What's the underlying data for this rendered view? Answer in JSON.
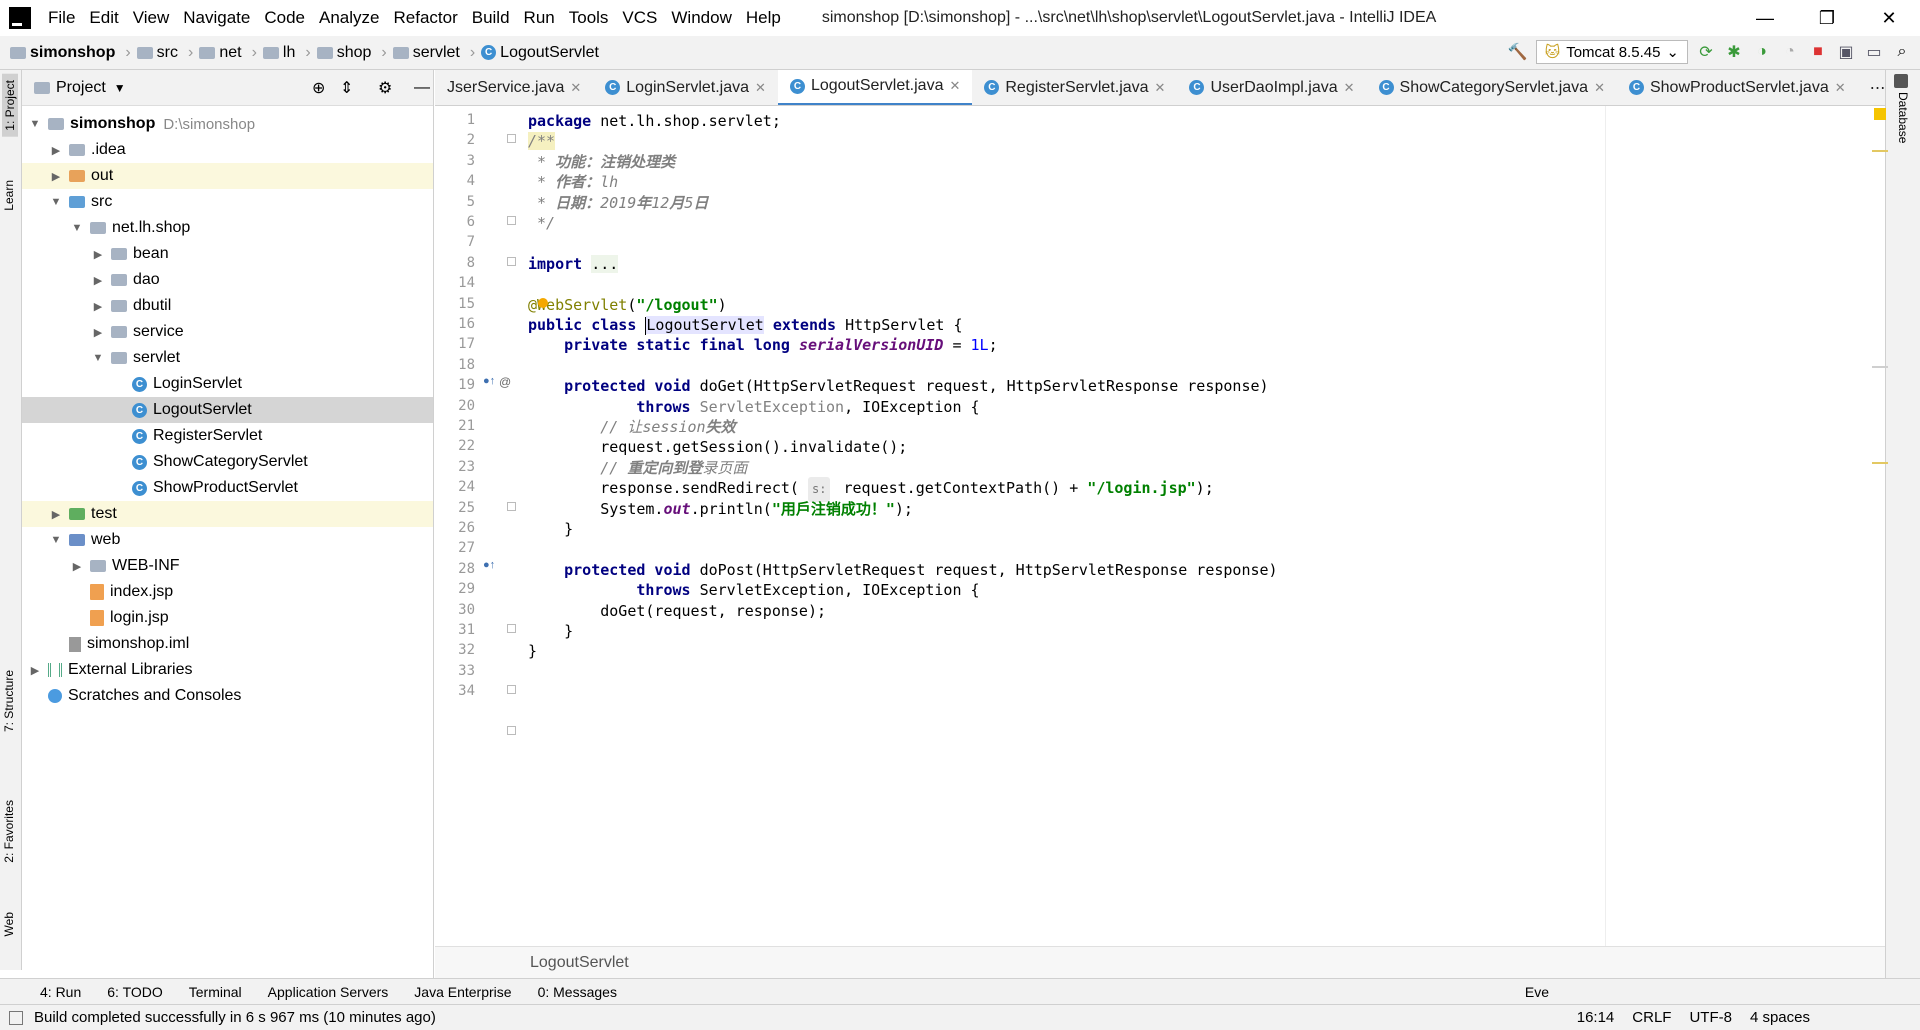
{
  "window": {
    "title": "simonshop [D:\\simonshop] - ...\\src\\net\\lh\\shop\\servlet\\LogoutServlet.java - IntelliJ IDEA",
    "minimize": "—",
    "maximize": "❐",
    "close": "✕"
  },
  "menu": [
    "File",
    "Edit",
    "View",
    "Navigate",
    "Code",
    "Analyze",
    "Refactor",
    "Build",
    "Run",
    "Tools",
    "VCS",
    "Window",
    "Help"
  ],
  "breadcrumb": [
    "simonshop",
    "src",
    "net",
    "lh",
    "shop",
    "servlet",
    "LogoutServlet"
  ],
  "run_config": "Tomcat 8.5.45",
  "left_tabs": {
    "project": "1: Project",
    "learn": "Learn",
    "structure": "7: Structure",
    "favorites": "2: Favorites",
    "web": "Web"
  },
  "right_tabs": {
    "database": "Database"
  },
  "project_panel": {
    "title": "Project",
    "tree": [
      {
        "label": "simonshop",
        "extra": "D:\\simonshop",
        "indent": 0,
        "arrow": "▼",
        "icon": "folder"
      },
      {
        "label": ".idea",
        "indent": 1,
        "arrow": "▶",
        "icon": "folder"
      },
      {
        "label": "out",
        "indent": 1,
        "arrow": "▶",
        "icon": "folder-orange",
        "hl": true
      },
      {
        "label": "src",
        "indent": 1,
        "arrow": "▼",
        "icon": "folder-blue"
      },
      {
        "label": "net.lh.shop",
        "indent": 2,
        "arrow": "▼",
        "icon": "package"
      },
      {
        "label": "bean",
        "indent": 3,
        "arrow": "▶",
        "icon": "package"
      },
      {
        "label": "dao",
        "indent": 3,
        "arrow": "▶",
        "icon": "package"
      },
      {
        "label": "dbutil",
        "indent": 3,
        "arrow": "▶",
        "icon": "package"
      },
      {
        "label": "service",
        "indent": 3,
        "arrow": "▶",
        "icon": "package"
      },
      {
        "label": "servlet",
        "indent": 3,
        "arrow": "▼",
        "icon": "package"
      },
      {
        "label": "LoginServlet",
        "indent": 4,
        "arrow": "",
        "icon": "class"
      },
      {
        "label": "LogoutServlet",
        "indent": 4,
        "arrow": "",
        "icon": "class",
        "sel": true
      },
      {
        "label": "RegisterServlet",
        "indent": 4,
        "arrow": "",
        "icon": "class"
      },
      {
        "label": "ShowCategoryServlet",
        "indent": 4,
        "arrow": "",
        "icon": "class"
      },
      {
        "label": "ShowProductServlet",
        "indent": 4,
        "arrow": "",
        "icon": "class"
      },
      {
        "label": "test",
        "indent": 1,
        "arrow": "▶",
        "icon": "folder-green",
        "hl": true
      },
      {
        "label": "web",
        "indent": 1,
        "arrow": "▼",
        "icon": "folder-web"
      },
      {
        "label": "WEB-INF",
        "indent": 2,
        "arrow": "▶",
        "icon": "folder"
      },
      {
        "label": "index.jsp",
        "indent": 2,
        "arrow": "",
        "icon": "jsp"
      },
      {
        "label": "login.jsp",
        "indent": 2,
        "arrow": "",
        "icon": "jsp"
      },
      {
        "label": "simonshop.iml",
        "indent": 1,
        "arrow": "",
        "icon": "file"
      },
      {
        "label": "External Libraries",
        "indent": 0,
        "arrow": "▶",
        "icon": "lib"
      },
      {
        "label": "Scratches and Consoles",
        "indent": 0,
        "arrow": "",
        "icon": "scratch"
      }
    ]
  },
  "editor_tabs": [
    {
      "label": "JserService.java",
      "active": false
    },
    {
      "label": "LoginServlet.java",
      "active": false
    },
    {
      "label": "LogoutServlet.java",
      "active": true
    },
    {
      "label": "RegisterServlet.java",
      "active": false
    },
    {
      "label": "UserDaoImpl.java",
      "active": false
    },
    {
      "label": "ShowCategoryServlet.java",
      "active": false
    },
    {
      "label": "ShowProductServlet.java",
      "active": false
    }
  ],
  "code_lines": [
    {
      "n": "1",
      "html": "<span class='kw'>package</span> net.lh.shop.servlet;"
    },
    {
      "n": "2",
      "html": "<span class='cmt' style='background:#f5f0c0'>/**</span>"
    },
    {
      "n": "3",
      "html": "<span class='cmt'> * <b>功能：注销处理类</b></span>"
    },
    {
      "n": "4",
      "html": "<span class='cmt'> * <b>作者：</b>lh</span>"
    },
    {
      "n": "5",
      "html": "<span class='cmt'> * <b>日期：</b>2019<b>年</b>12<b>月</b>5<b>日</b></span>"
    },
    {
      "n": "6",
      "html": "<span class='cmt'> */</span>"
    },
    {
      "n": "7",
      "html": ""
    },
    {
      "n": "8",
      "html": "<span class='kw'>import</span> <span style='background:#eef5ea'>...</span>"
    },
    {
      "n": "14",
      "html": ""
    },
    {
      "n": "15",
      "html": "<span class='ann'>@WebServlet</span>(<span class='str'>\"/logout\"</span>)"
    },
    {
      "n": "16",
      "html": "<span class='kw'>public class</span> <span class='caret'></span><span class='ident'>LogoutServlet</span> <span class='kw'>extends</span> HttpServlet {"
    },
    {
      "n": "17",
      "html": "    <span class='kw'>private static final long</span> <span class='fld'>serialVersionUID</span> = <span class='num'>1L</span>;"
    },
    {
      "n": "18",
      "html": ""
    },
    {
      "n": "19",
      "html": "    <span class='kw'>protected void</span> doGet(HttpServletRequest request, HttpServletResponse response)"
    },
    {
      "n": "20",
      "html": "            <span class='kw'>throws</span> <span class='muted'>ServletException</span>, IOException {"
    },
    {
      "n": "21",
      "html": "        <span class='cmt'>// 让session<b>失效</b></span>"
    },
    {
      "n": "22",
      "html": "        request.getSession().invalidate();"
    },
    {
      "n": "23",
      "html": "        <span class='cmt'>// <b>重定向到登</b>录页面</span>"
    },
    {
      "n": "24",
      "html": "        response.sendRedirect( <span class='hint'>s:</span> request.getContextPath() + <span class='str'>\"/login.jsp\"</span>);"
    },
    {
      "n": "25",
      "html": "        System.<span class='fld'>out</span>.println(<span class='str'>\"用戶注销成功！\"</span>);"
    },
    {
      "n": "26",
      "html": "    }"
    },
    {
      "n": "27",
      "html": ""
    },
    {
      "n": "28",
      "html": "    <span class='kw'>protected void</span> doPost(HttpServletRequest request, HttpServletResponse response)"
    },
    {
      "n": "29",
      "html": "            <span class='kw'>throws</span> ServletException, IOException {"
    },
    {
      "n": "30",
      "html": "        doGet(request, response);"
    },
    {
      "n": "31",
      "html": "    }"
    },
    {
      "n": "32",
      "html": "}"
    },
    {
      "n": "33",
      "html": ""
    },
    {
      "n": "34",
      "html": ""
    }
  ],
  "editor_breadcrumb": "LogoutServlet",
  "tool_windows": [
    "4: Run",
    "6: TODO",
    "Terminal",
    "Application Servers",
    "Java Enterprise",
    "0: Messages"
  ],
  "event_log": "Eve",
  "status": {
    "message": "Build completed successfully in 6 s 967 ms (10 minutes ago)",
    "position": "16:14",
    "line_sep": "CRLF",
    "encoding": "UTF-8",
    "indent": "4 spaces"
  }
}
